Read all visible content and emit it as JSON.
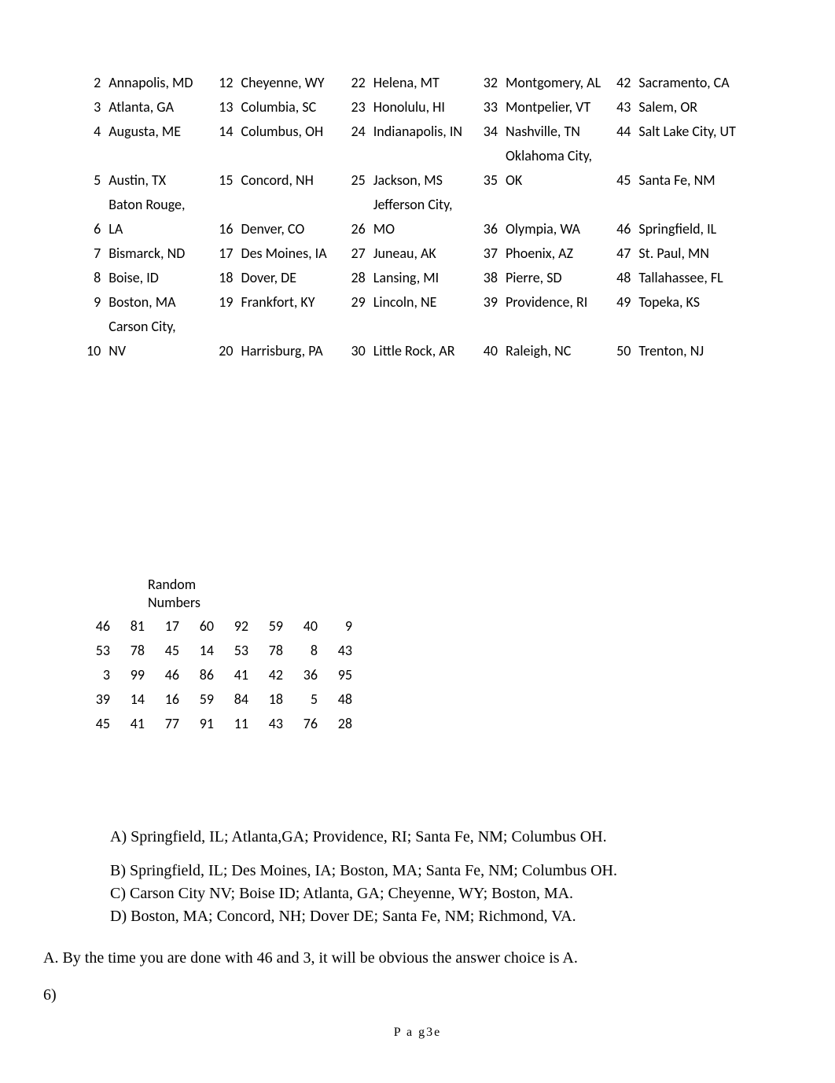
{
  "cities_rows": [
    {
      "c1n": "2",
      "c1": "Annapolis, MD",
      "c2n": "12",
      "c2": "Cheyenne, WY",
      "c3n": "22",
      "c3": "Helena, MT",
      "c4n": "32",
      "c4": "Montgomery, AL",
      "c5n": "42",
      "c5": "Sacramento, CA"
    },
    {
      "c1n": "3",
      "c1": "Atlanta, GA",
      "c2n": "13",
      "c2": "Columbia, SC",
      "c3n": "23",
      "c3": "Honolulu, HI",
      "c4n": "33",
      "c4": "Montpelier, VT",
      "c5n": "43",
      "c5": "Salem, OR"
    },
    {
      "c1n": "4",
      "c1": "Augusta, ME",
      "c2n": "14",
      "c2": "Columbus, OH",
      "c3n": "24",
      "c3": "Indianapolis, IN",
      "c4n": "34",
      "c4": "Nashville, TN",
      "c5n": "44",
      "c5": "Salt Lake City, UT"
    },
    {
      "c1n": "",
      "c1": "",
      "c2n": "",
      "c2": "",
      "c3n": "",
      "c3": "",
      "c4n": "",
      "c4": "Oklahoma City,",
      "c5n": "",
      "c5": ""
    },
    {
      "c1n": "5",
      "c1": "Austin, TX",
      "c2n": "15",
      "c2": "Concord, NH",
      "c3n": "25",
      "c3": "Jackson, MS",
      "c4n": "35",
      "c4": "OK",
      "c5n": "45",
      "c5": "Santa Fe, NM"
    },
    {
      "c1n": "",
      "c1": "Baton Rouge,",
      "c2n": "",
      "c2": "",
      "c3n": "",
      "c3": "Jefferson City,",
      "c4n": "",
      "c4": "",
      "c5n": "",
      "c5": ""
    },
    {
      "c1n": "6",
      "c1": "LA",
      "c2n": "16",
      "c2": "Denver, CO",
      "c3n": "26",
      "c3": "MO",
      "c4n": "36",
      "c4": "Olympia, WA",
      "c5n": "46",
      "c5": "Springfield, IL"
    },
    {
      "c1n": "7",
      "c1": "Bismarck, ND",
      "c2n": "17",
      "c2": "Des Moines, IA",
      "c3n": "27",
      "c3": "Juneau, AK",
      "c4n": "37",
      "c4": "Phoenix, AZ",
      "c5n": "47",
      "c5": "St. Paul, MN"
    },
    {
      "c1n": "8",
      "c1": "Boise, ID",
      "c2n": "18",
      "c2": "Dover, DE",
      "c3n": "28",
      "c3": "Lansing, MI",
      "c4n": "38",
      "c4": "Pierre, SD",
      "c5n": "48",
      "c5": "Tallahassee, FL"
    },
    {
      "c1n": "9",
      "c1": "Boston, MA",
      "c2n": "19",
      "c2": "Frankfort, KY",
      "c3n": "29",
      "c3": "Lincoln, NE",
      "c4n": "39",
      "c4": "Providence, RI",
      "c5n": "49",
      "c5": "Topeka, KS"
    },
    {
      "c1n": "",
      "c1": "Carson City,",
      "c2n": "",
      "c2": "",
      "c3n": "",
      "c3": "",
      "c4n": "",
      "c4": "",
      "c5n": "",
      "c5": ""
    },
    {
      "c1n": "10",
      "c1": "NV",
      "c2n": "20",
      "c2": "Harrisburg, PA",
      "c3n": "30",
      "c3": "Little Rock, AR",
      "c4n": "40",
      "c4": "Raleigh, NC",
      "c5n": "50",
      "c5": "Trenton, NJ"
    }
  ],
  "random": {
    "header_line1": "Random",
    "header_line2": "Numbers",
    "rows": [
      [
        "46",
        "81",
        "17",
        "60",
        "92",
        "59",
        "40",
        "9"
      ],
      [
        "53",
        "78",
        "45",
        "14",
        "53",
        "78",
        "8",
        "43"
      ],
      [
        "3",
        "99",
        "46",
        "86",
        "41",
        "42",
        "36",
        "95"
      ],
      [
        "39",
        "14",
        "16",
        "59",
        "84",
        "18",
        "5",
        "48"
      ],
      [
        "45",
        "41",
        "77",
        "91",
        "11",
        "43",
        "76",
        "28"
      ]
    ]
  },
  "answers": {
    "a": "A) Springfield, IL; Atlanta,GA; Providence, RI; Santa Fe, NM; Columbus OH.",
    "b": "B) Springfield, IL; Des Moines, IA; Boston, MA; Santa Fe, NM; Columbus OH.",
    "c": "C) Carson City NV; Boise ID; Atlanta, GA; Cheyenne, WY; Boston, MA.",
    "d": "D) Boston, MA; Concord, NH; Dover DE; Santa Fe, NM; Richmond, VA."
  },
  "explain": "A.  By the time you are done with 46 and 3, it will be obvious the answer choice is A.",
  "q6": "6)",
  "footer": "P a g3e"
}
